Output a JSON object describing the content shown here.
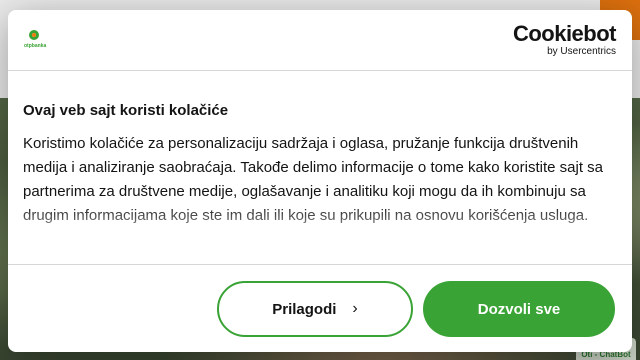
{
  "background": {
    "chatbot_label": "Oti - ChatBot",
    "accent_color": "#f07a10"
  },
  "dialog": {
    "site_logo_text": "otpbanka",
    "brand": {
      "name": "Cookiebot",
      "sub": "by Usercentrics"
    },
    "title": "Ovaj veb sajt koristi kolačiće",
    "text": "Koristimo kolačiće za personalizaciju sadržaja i oglasa, pružanje funkcija društvenih medija i analiziranje saobraćaja. Takođe delimo informacije o tome kako koristite sajt sa partnerima za društvene medije, oglašavanje i analitiku koji mogu da ih kombinuju sa drugim informacijama koje ste im dali ili koje su prikupili na osnovu korišćenja usluga.",
    "buttons": {
      "customize": "Prilagodi",
      "allow_all": "Dozvoli sve"
    },
    "colors": {
      "primary": "#3aa335",
      "text": "#141414"
    }
  }
}
